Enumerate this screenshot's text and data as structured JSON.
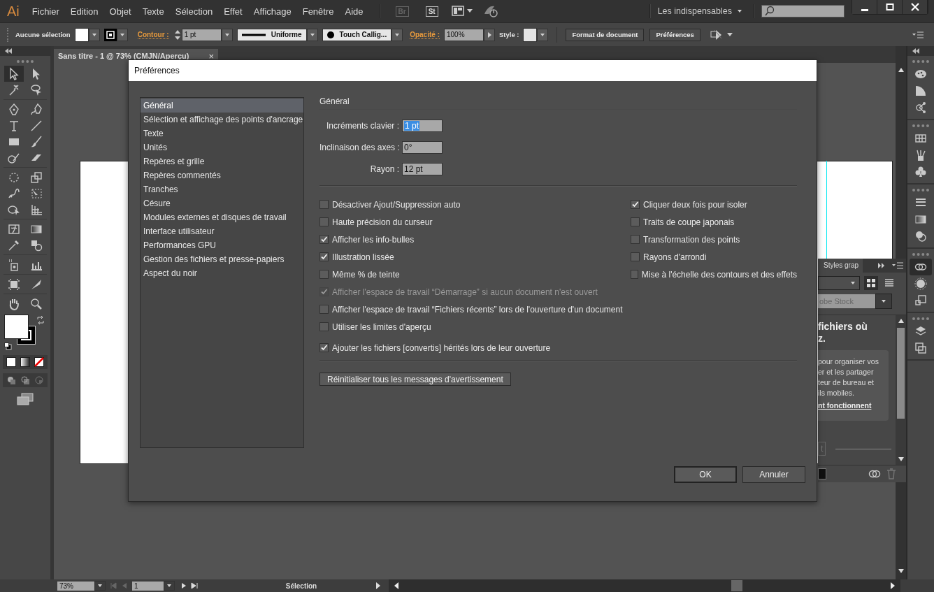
{
  "menu_bar": {
    "logo": "Ai",
    "menus": [
      "Fichier",
      "Edition",
      "Objet",
      "Texte",
      "Sélection",
      "Effet",
      "Affichage",
      "Fenêtre",
      "Aide"
    ],
    "bridge": "Br",
    "stock": "St",
    "workspace": "Les indispensables"
  },
  "control_bar": {
    "selection": "Aucune sélection",
    "stroke_label": "Contour :",
    "stroke_weight": "1 pt",
    "stroke_profile": "Uniforme",
    "brush": "Touch Callig...",
    "opacity_label": "Opacité :",
    "opacity": "100%",
    "style_label": "Style :",
    "buttons": [
      "Format de document",
      "Préférences"
    ]
  },
  "document_tab": {
    "title": "Sans titre - 1 @ 73% (CMJN/Aperçu)",
    "close": "×"
  },
  "tools": [
    {
      "kind": "selection",
      "selected": true
    },
    {
      "kind": "direct",
      "selected": false
    },
    {
      "kind": "wand",
      "selected": false
    },
    {
      "kind": "lasso",
      "selected": false
    },
    {
      "kind": "pen",
      "selected": false
    },
    {
      "kind": "curvature",
      "selected": false
    },
    {
      "kind": "type",
      "selected": false
    },
    {
      "kind": "line",
      "selected": false
    },
    {
      "kind": "rectangle",
      "selected": false
    },
    {
      "kind": "brush",
      "selected": false
    },
    {
      "kind": "shaper",
      "selected": false
    },
    {
      "kind": "eraser",
      "selected": false
    },
    {
      "kind": "rotate",
      "selected": false
    },
    {
      "kind": "scale",
      "selected": false
    },
    {
      "kind": "puppet",
      "selected": false
    },
    {
      "kind": "transform",
      "selected": false
    },
    {
      "kind": "builder",
      "selected": false
    },
    {
      "kind": "perspective",
      "selected": false
    },
    {
      "kind": "mesh",
      "selected": false
    },
    {
      "kind": "gradient",
      "selected": false
    },
    {
      "kind": "eyedropper",
      "selected": false
    },
    {
      "kind": "blend",
      "selected": false
    },
    {
      "kind": "sprayer",
      "selected": false
    },
    {
      "kind": "graph",
      "selected": false
    },
    {
      "kind": "artboard",
      "selected": false
    },
    {
      "kind": "slice",
      "selected": false
    },
    {
      "kind": "hand",
      "selected": false
    },
    {
      "kind": "zoom",
      "selected": false
    }
  ],
  "dock": [
    {
      "kind": "palette",
      "selected": false
    },
    {
      "kind": "guide",
      "selected": false
    },
    {
      "kind": "share",
      "selected": false
    },
    {
      "kind": "swatches",
      "selected": false
    },
    {
      "kind": "brushes",
      "selected": false
    },
    {
      "kind": "club",
      "selected": false
    },
    {
      "kind": "stroke",
      "selected": false
    },
    {
      "kind": "gradient",
      "selected": false
    },
    {
      "kind": "transparency",
      "selected": false
    },
    {
      "kind": "cloud",
      "selected": true
    },
    {
      "kind": "circle",
      "selected": false
    },
    {
      "kind": "transform",
      "selected": false
    },
    {
      "kind": "layers",
      "selected": false
    },
    {
      "kind": "artboards",
      "selected": false
    }
  ],
  "libraries_panel": {
    "tab": "Styles grap",
    "view_modes": [
      {
        "kind": "grid",
        "selected": true
      },
      {
        "kind": "list",
        "selected": false
      }
    ],
    "search_placeholder": "obe Stock",
    "heading_lines": [
      "fichiers où",
      "z."
    ],
    "card_lines": [
      "pour organiser vos",
      "er et les partager",
      "teur de bureau et",
      "ils mobiles."
    ],
    "link": "nt fonctionnent",
    "button": "t"
  },
  "dialog": {
    "title": "Préférences",
    "categories": [
      {
        "label": "Général",
        "selected": true
      },
      {
        "label": "Sélection et affichage des points d'ancrage",
        "selected": false
      },
      {
        "label": "Texte",
        "selected": false
      },
      {
        "label": "Unités",
        "selected": false
      },
      {
        "label": "Repères et grille",
        "selected": false
      },
      {
        "label": "Repères commentés",
        "selected": false
      },
      {
        "label": "Tranches",
        "selected": false
      },
      {
        "label": "Césure",
        "selected": false
      },
      {
        "label": "Modules externes et disques de travail",
        "selected": false
      },
      {
        "label": "Interface utilisateur",
        "selected": false
      },
      {
        "label": "Performances GPU",
        "selected": false
      },
      {
        "label": "Gestion des fichiers et presse-papiers",
        "selected": false
      },
      {
        "label": "Aspect du noir",
        "selected": false
      }
    ],
    "section": "Général",
    "fields": [
      {
        "label": "Incréments clavier :",
        "value": "1 pt",
        "focused": true
      },
      {
        "label": "Inclinaison des axes :",
        "value": "0°",
        "focused": false
      },
      {
        "label": "Rayon :",
        "value": "12 pt",
        "focused": false
      }
    ],
    "options_left": [
      {
        "label": "Désactiver Ajout/Suppression auto",
        "checked": false,
        "disabled": false
      },
      {
        "label": "Haute précision du curseur",
        "checked": false,
        "disabled": false
      },
      {
        "label": "Afficher les info-bulles",
        "checked": true,
        "disabled": false
      },
      {
        "label": "Illustration lissée",
        "checked": true,
        "disabled": false
      },
      {
        "label": "Même % de teinte",
        "checked": false,
        "disabled": false
      },
      {
        "label": "Afficher l'espace de travail “Démarrage” si aucun document n'est ouvert",
        "checked": true,
        "disabled": true
      },
      {
        "label": "Afficher l'espace de travail “Fichiers récents” lors de l'ouverture d'un document",
        "checked": false,
        "disabled": false
      },
      {
        "label": "Utiliser les limites d'aperçu",
        "checked": false,
        "disabled": false
      }
    ],
    "options_bottom": [
      {
        "label": "Ajouter les fichiers [convertis] hérités lors de leur ouverture",
        "checked": true,
        "disabled": false
      }
    ],
    "options_right": [
      {
        "label": "Cliquer deux fois pour isoler",
        "checked": true,
        "disabled": false
      },
      {
        "label": "Traits de coupe japonais",
        "checked": false,
        "disabled": false
      },
      {
        "label": "Transformation des points",
        "checked": false,
        "disabled": false
      },
      {
        "label": "Rayons d'arrondi",
        "checked": false,
        "disabled": false
      },
      {
        "label": "Mise à l'échelle des contours et des effets",
        "checked": false,
        "disabled": false
      }
    ],
    "reset_button": "Réinitialiser tous les messages d'avertissement",
    "buttons": [
      {
        "label": "OK",
        "default": true
      },
      {
        "label": "Annuler",
        "default": false
      }
    ]
  },
  "status_bar": {
    "zoom": "73%",
    "artboard": "1",
    "tool": "Sélection"
  }
}
